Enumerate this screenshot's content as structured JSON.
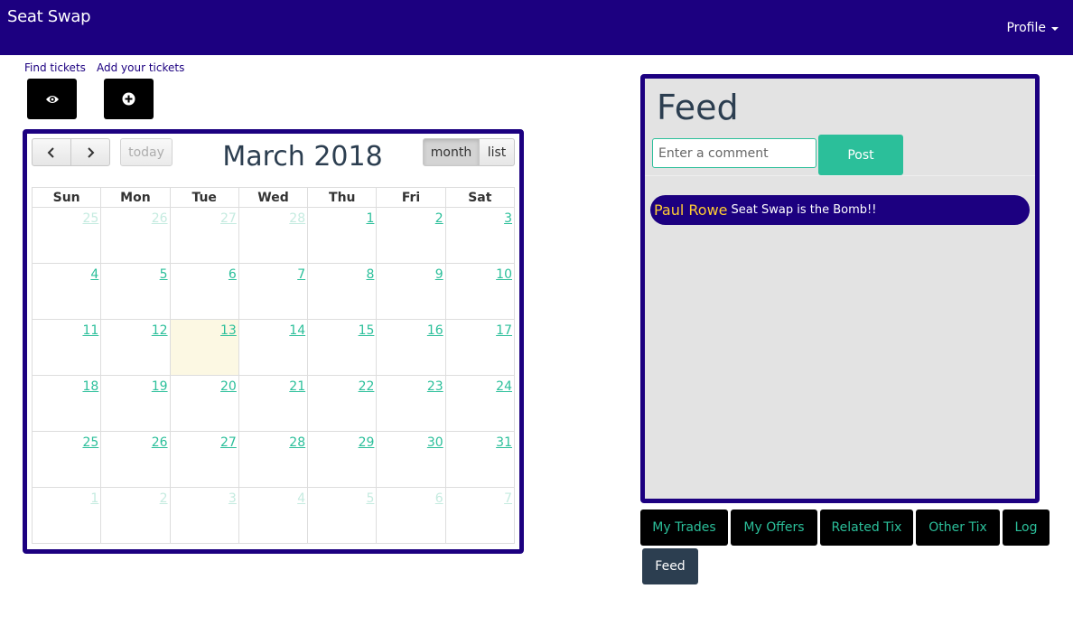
{
  "navbar": {
    "brand": "Seat Swap",
    "profile_label": "Profile"
  },
  "quick_actions": {
    "find_label": "Find tickets",
    "add_label": "Add your tickets",
    "find_icon": "eye-icon",
    "add_icon": "plus-circle-icon"
  },
  "calendar": {
    "title": "March 2018",
    "prev_icon": "chevron-left-icon",
    "next_icon": "chevron-right-icon",
    "today_label": "today",
    "views": {
      "month": "month",
      "list": "list",
      "active": "month"
    },
    "weekdays": [
      "Sun",
      "Mon",
      "Tue",
      "Wed",
      "Thu",
      "Fri",
      "Sat"
    ],
    "weeks": [
      [
        "25",
        "26",
        "27",
        "28",
        "1",
        "2",
        "3"
      ],
      [
        "4",
        "5",
        "6",
        "7",
        "8",
        "9",
        "10"
      ],
      [
        "11",
        "12",
        "13",
        "14",
        "15",
        "16",
        "17"
      ],
      [
        "18",
        "19",
        "20",
        "21",
        "22",
        "23",
        "24"
      ],
      [
        "25",
        "26",
        "27",
        "28",
        "29",
        "30",
        "31"
      ],
      [
        "1",
        "2",
        "3",
        "4",
        "5",
        "6",
        "7"
      ]
    ],
    "today": "13"
  },
  "feed": {
    "title": "Feed",
    "comment_placeholder": "Enter a comment",
    "post_label": "Post",
    "items": [
      {
        "author": "Paul Rowe",
        "text": "Seat Swap is the Bomb!!"
      }
    ]
  },
  "tabs": [
    "My Trades",
    "My Offers",
    "Related Tix",
    "Other Tix",
    "Log",
    "Feed"
  ],
  "active_tab": "Feed",
  "colors": {
    "brand": "#1c0080",
    "accent": "#2bbf9a",
    "author": "#ffcc33",
    "today_bg": "#fcf8e3"
  }
}
